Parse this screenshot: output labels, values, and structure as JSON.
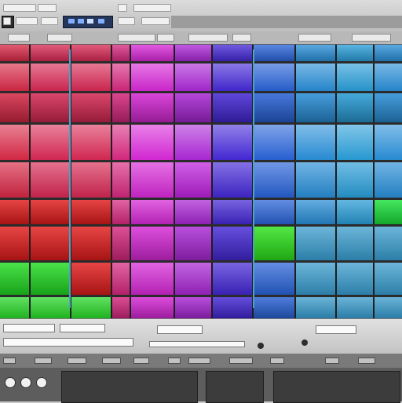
{
  "app": {
    "title": ""
  },
  "colors": {
    "accent": "#49a4c8",
    "grid_background": "#2a2a2a",
    "toolbar": "#c9c9c9",
    "device_panel": "#3c3c3c"
  },
  "icons": [
    "stop-icon",
    "transport-display-icon",
    "record-icon",
    "round-button-icon"
  ],
  "grid": {
    "columns": 11,
    "rows": 9,
    "cells_note": ""
  }
}
